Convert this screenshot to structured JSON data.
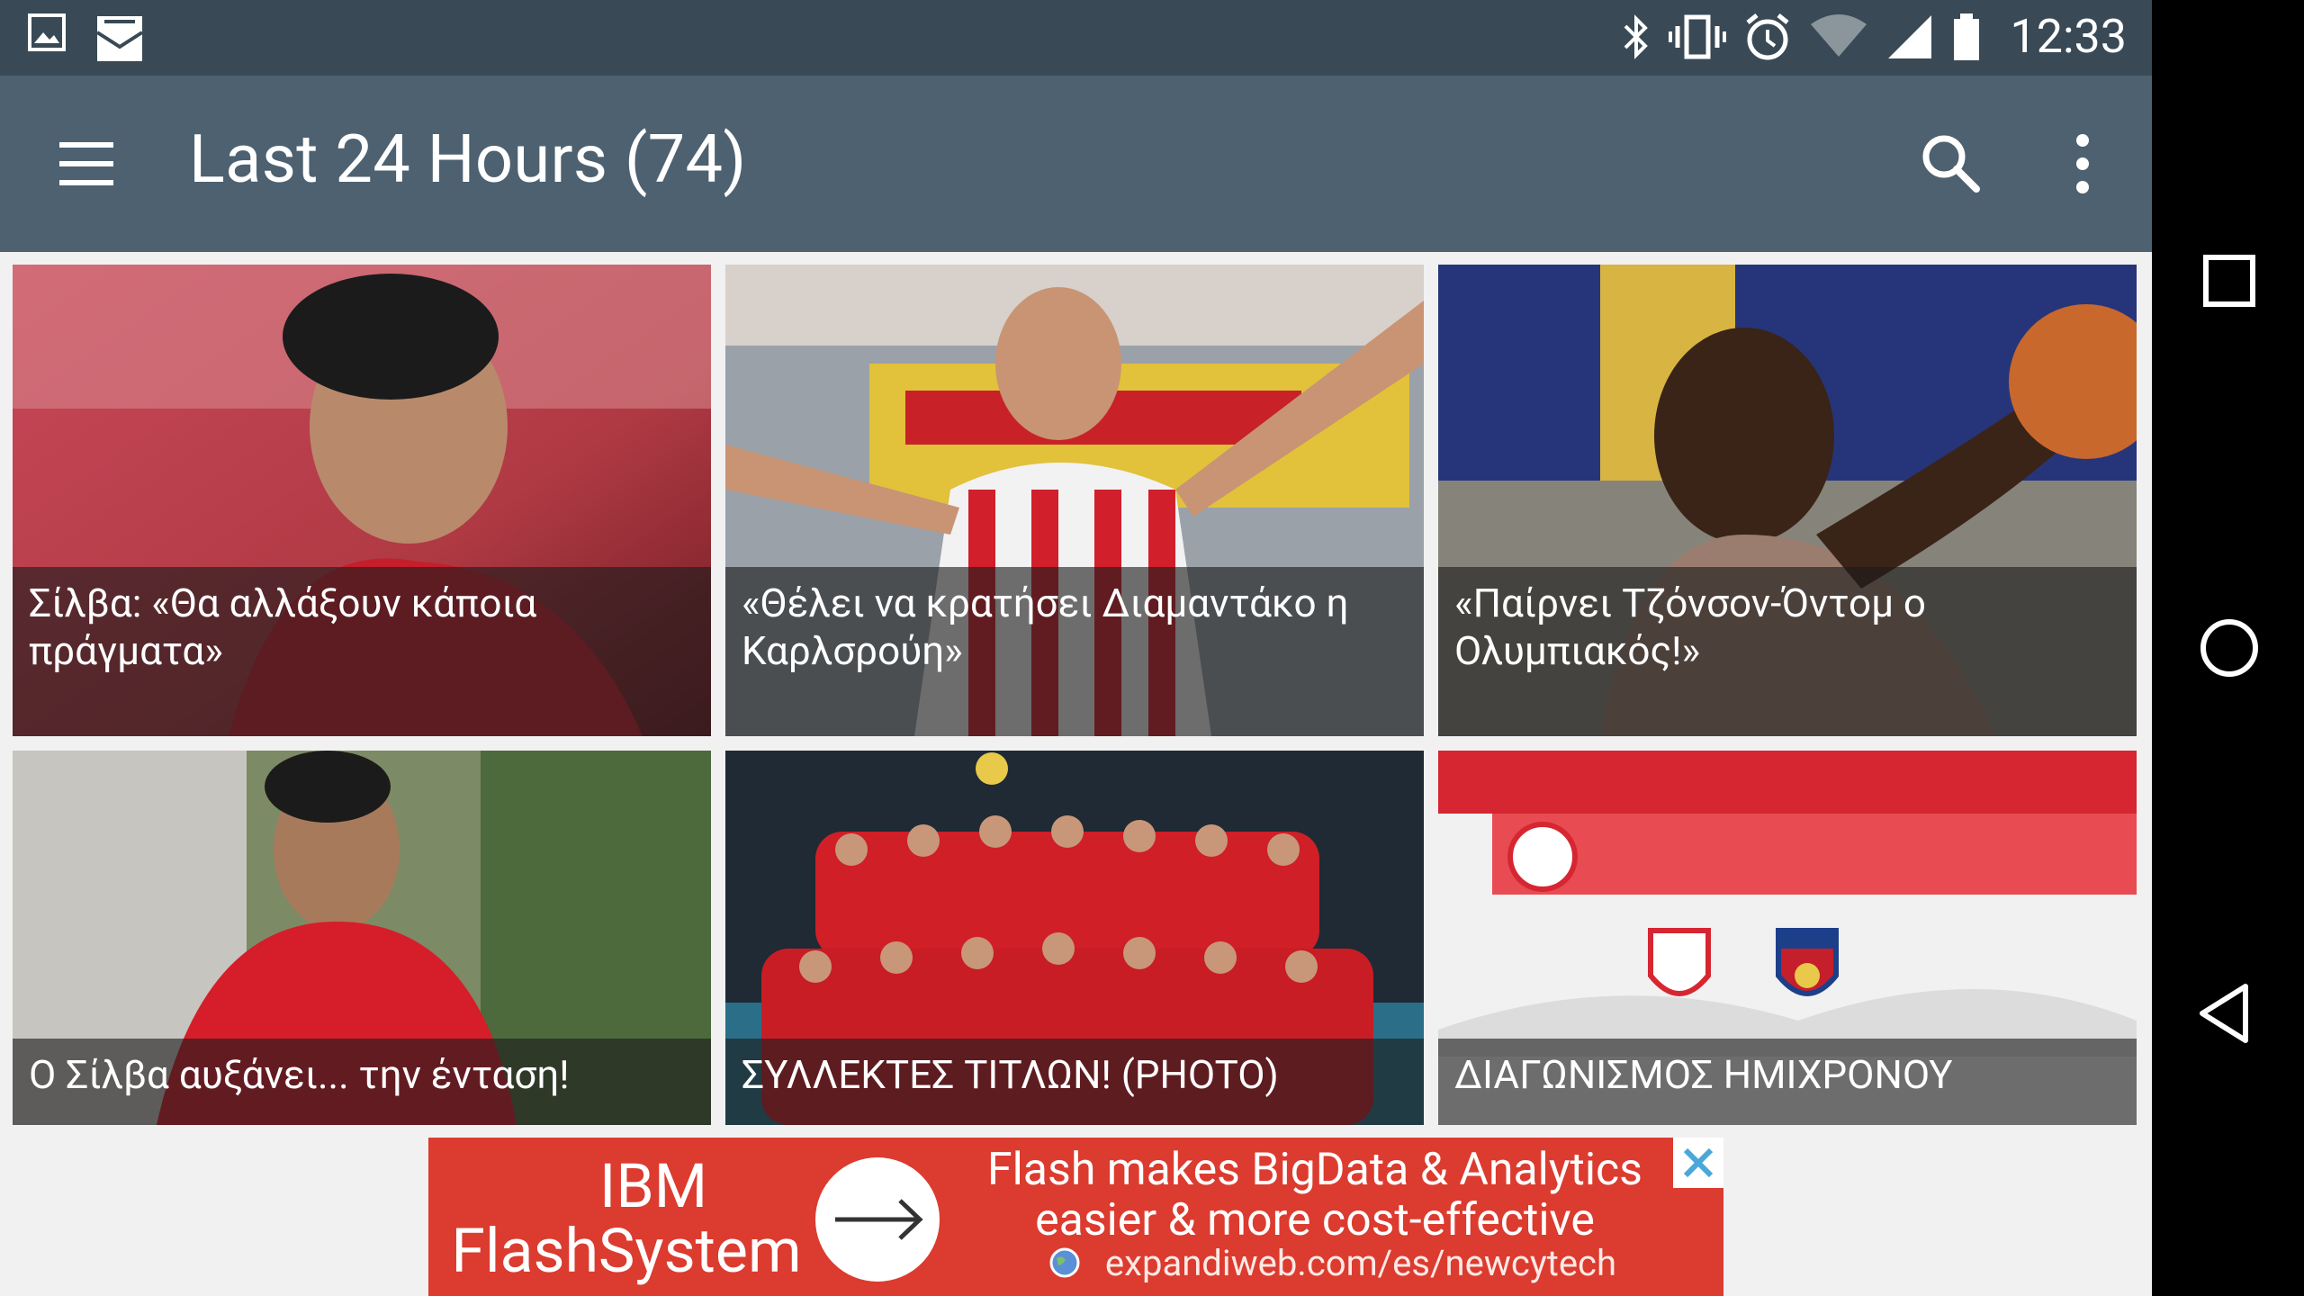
{
  "status_bar": {
    "time": "12:33",
    "left_icons": [
      "image-icon",
      "mail-icon"
    ],
    "right_icons": [
      "bluetooth-icon",
      "vibrate-icon",
      "alarm-icon",
      "wifi-icon",
      "signal-icon",
      "battery-icon"
    ]
  },
  "app_bar": {
    "title": "Last 24 Hours (74)",
    "actions": [
      "menu-icon",
      "search-icon",
      "more-vert-icon"
    ]
  },
  "articles": [
    {
      "caption_lines": [
        "Σίλβα: «Θα αλλάξουν κάποια",
        "πράγματα»"
      ]
    },
    {
      "caption_lines": [
        "«Θέλει να κρατήσει Διαμαντάκο η",
        "Καρλσρούη»"
      ]
    },
    {
      "caption_lines": [
        "«Παίρνει Τζόνσον-Όντομ ο",
        "Ολυμπιακός!»"
      ]
    },
    {
      "caption_lines": [
        "Ο Σίλβα αυξάνει... την ένταση!"
      ]
    },
    {
      "caption_lines": [
        "ΣΥΛΛΕΚΤΕΣ ΤΙΤΛΩΝ! (PHOTO)"
      ]
    },
    {
      "caption_lines": [
        "ΔΙΑΓΩΝΙΣΜΟΣ ΗΜΙΧΡΟΝΟΥ"
      ]
    }
  ],
  "ad": {
    "brand_line1": "IBM",
    "brand_line2": "FlashSystem",
    "headline_line1": "Flash makes BigData & Analytics",
    "headline_line2": "easier & more cost-effective",
    "link": "expandiweb.com/es/newcytech"
  },
  "nav_bar": [
    "recents-icon",
    "home-icon",
    "back-icon"
  ],
  "colors": {
    "status_bar": "#394955",
    "app_bar": "#4d6170",
    "ad_background": "#dc3b2f"
  }
}
